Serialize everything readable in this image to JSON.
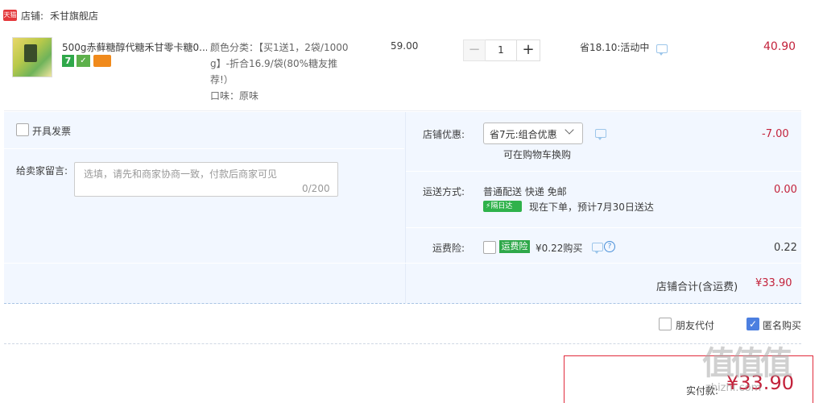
{
  "shop": {
    "badge": "天猫",
    "label": "店铺:",
    "name": "禾甘旗舰店"
  },
  "item": {
    "title": "500g赤藓糖醇代糖禾甘零卡糖0...",
    "badge7": "7",
    "sku_line1": "颜色分类：【买1送1，2袋/1000",
    "sku_line2": "g】-折合16.9/袋(80%糖友推",
    "sku_line3": "荐!）",
    "flavor": "口味：原味",
    "price": "59.00",
    "quantity": "1",
    "minus": "−",
    "plus": "+",
    "save": "省18.10:活动中",
    "total": "40.90"
  },
  "invoice": {
    "label": "开具发票"
  },
  "memo": {
    "label": "给卖家留言:",
    "placeholder": "选填，请先和商家协商一致，付款后商家可见",
    "count": "0/200"
  },
  "discount": {
    "label": "店铺优惠:",
    "selected": "省7元:组合优惠",
    "note": "可在购物车换购",
    "value": "-7.00"
  },
  "shipping": {
    "label": "运送方式:",
    "method": "普通配送 快递 免邮",
    "badge": "隔日达",
    "eta": "现在下单，预计7月30日送达",
    "value": "0.00"
  },
  "insurance": {
    "label": "运费险:",
    "badge": "运费险",
    "text": "¥0.22购买",
    "help": "?",
    "value": "0.22"
  },
  "subtotal": {
    "label": "店铺合计(含运费)",
    "value": "¥33.90"
  },
  "options": {
    "friend_pay": "朋友代付",
    "anonymous": "匿名购买"
  },
  "payment": {
    "label": "实付款:",
    "value": "¥33.90"
  },
  "watermark": {
    "logo": "值值值",
    "url": "zhizhi.com"
  }
}
